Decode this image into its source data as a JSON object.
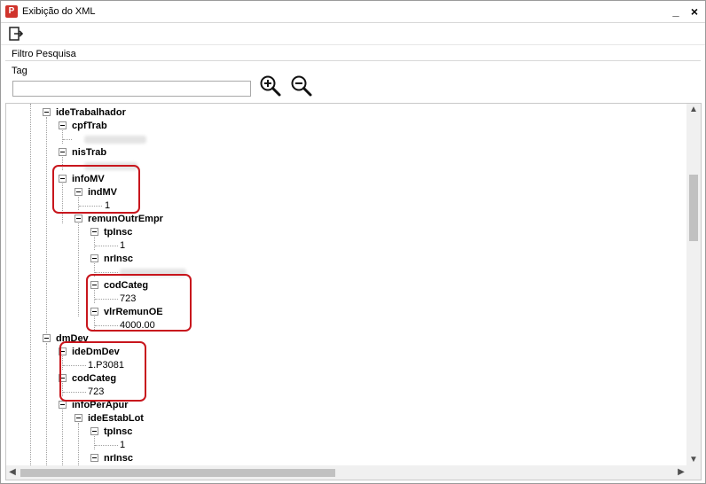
{
  "window": {
    "title": "Exibição do XML",
    "minimize_label": "_",
    "close_label": "×"
  },
  "filter": {
    "section_label": "Filtro Pesquisa",
    "tag_label": "Tag",
    "tag_value": ""
  },
  "tree": {
    "ideTrabalhador": "ideTrabalhador",
    "cpfTrab": "cpfTrab",
    "nisTrab": "nisTrab",
    "infoMV": "infoMV",
    "indMV": "indMV",
    "indMV_value": "1",
    "remunOutrEmpr": "remunOutrEmpr",
    "tpInsc": "tpInsc",
    "tpInsc_value": "1",
    "nrInsc": "nrInsc",
    "codCateg": "codCateg",
    "codCateg_value": "723",
    "vlrRemunOE": "vlrRemunOE",
    "vlrRemunOE_value": "4000.00",
    "dmDev": "dmDev",
    "ideDmDev": "ideDmDev",
    "ideDmDev_value": "1.P3081",
    "codCateg2": "codCateg",
    "codCateg2_value": "723",
    "infoPerApur": "infoPerApur",
    "ideEstabLot": "ideEstabLot",
    "tpInsc2": "tpInsc",
    "tpInsc2_value": "1",
    "nrInsc2": "nrInsc"
  },
  "colors": {
    "highlight": "#c8161d",
    "app_icon": "#d0342c"
  }
}
